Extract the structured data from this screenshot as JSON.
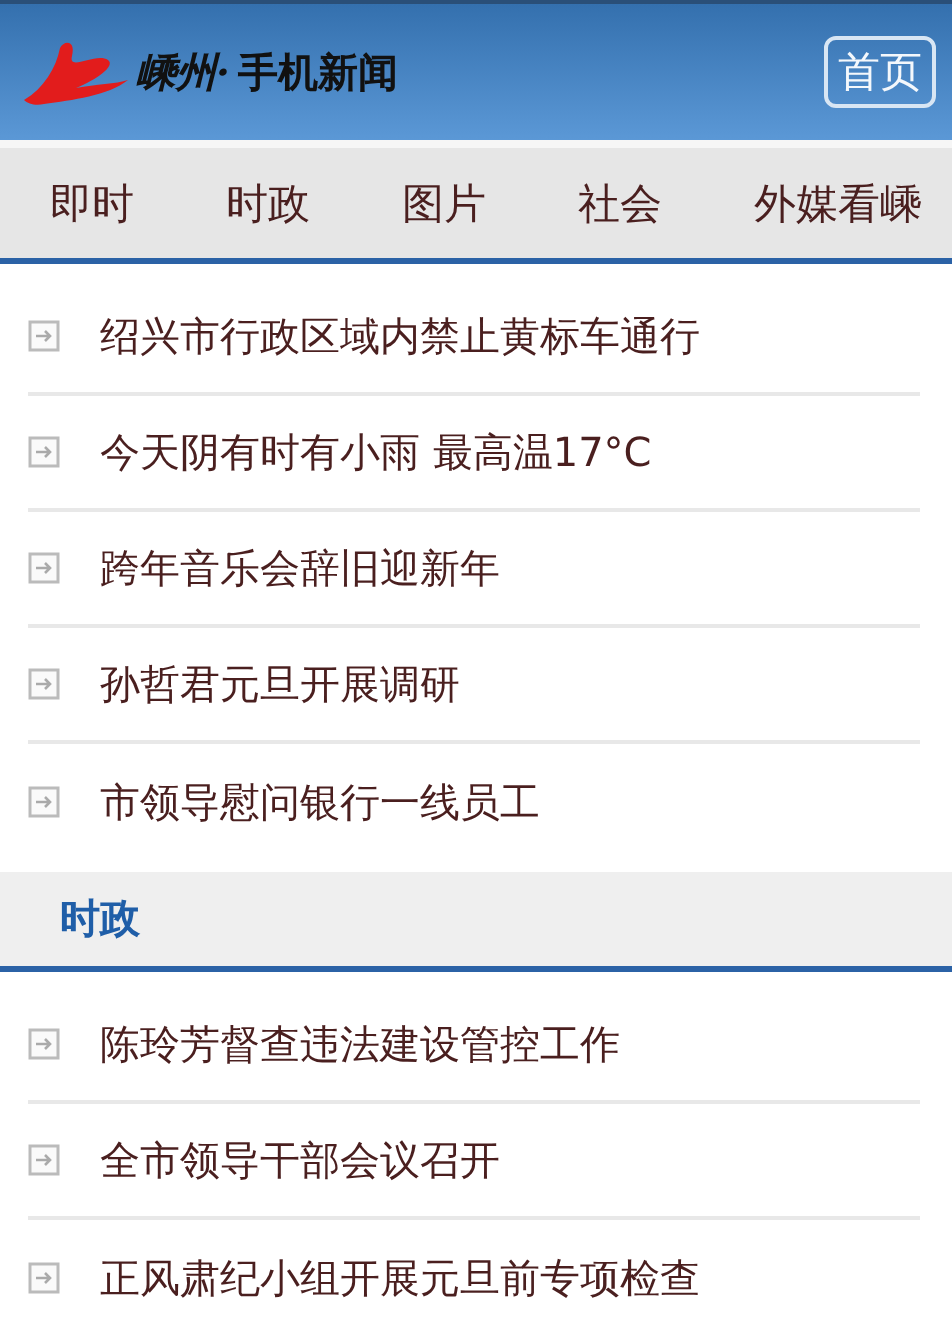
{
  "header": {
    "logo_script": "嵊州·",
    "logo_title": "手机新闻",
    "home_button": "首页"
  },
  "tabs": [
    {
      "label": "即时"
    },
    {
      "label": "时政"
    },
    {
      "label": "图片"
    },
    {
      "label": "社会"
    },
    {
      "label": "外媒看嵊"
    }
  ],
  "sections": [
    {
      "items": [
        "绍兴市行政区域内禁止黄标车通行",
        "今天阴有时有小雨 最高温17°C",
        "跨年音乐会辞旧迎新年",
        "孙哲君元旦开展调研",
        "市领导慰问银行一线员工"
      ]
    },
    {
      "title": "时政",
      "items": [
        "陈玲芳督查违法建设管控工作",
        "全市领导干部会议召开",
        "正风肃纪小组开展元旦前专项检查"
      ]
    }
  ]
}
